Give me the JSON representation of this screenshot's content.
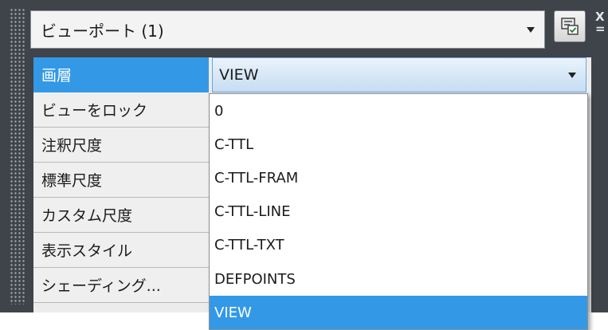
{
  "viewport_selector": {
    "label": "ビューポート (1)"
  },
  "side_label": [
    "X",
    "="
  ],
  "properties": [
    {
      "label": "画層",
      "selected": true
    },
    {
      "label": "ビューをロック"
    },
    {
      "label": "注釈尺度"
    },
    {
      "label": "標準尺度"
    },
    {
      "label": "カスタム尺度"
    },
    {
      "label": "表示スタイル"
    },
    {
      "label": "シェーディング..."
    }
  ],
  "layer_field": {
    "value": "VIEW"
  },
  "layer_options": [
    "0",
    "C-TTL",
    "C-TTL-FRAM",
    "C-TTL-LINE",
    "C-TTL-TXT",
    "DEFPOINTS",
    "VIEW"
  ],
  "highlighted_option": "VIEW",
  "colors": {
    "panel_bg": "#3f434a",
    "selection_blue": "#3399e7"
  }
}
